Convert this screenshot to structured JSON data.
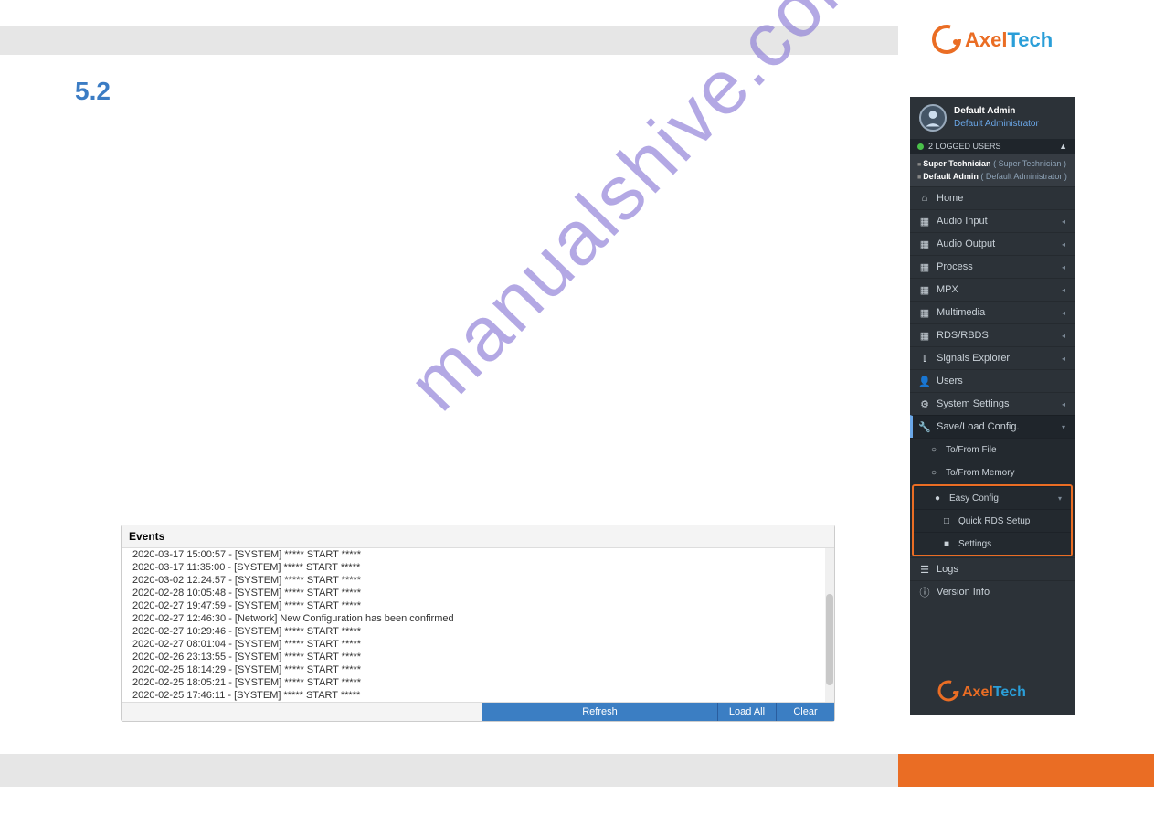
{
  "brand": {
    "part1": "Axel",
    "part2": "Tech"
  },
  "section_number": "5.2",
  "watermark": "manualshive.com",
  "events": {
    "title": "Events",
    "lines": [
      "2020-03-17 15:00:57 - [SYSTEM] ***** START *****",
      "2020-03-17 11:35:00 - [SYSTEM] ***** START *****",
      "2020-03-02 12:24:57 - [SYSTEM] ***** START *****",
      "2020-02-28 10:05:48 - [SYSTEM] ***** START *****",
      "2020-02-27 19:47:59 - [SYSTEM] ***** START *****",
      "2020-02-27 12:46:30 - [Network] New Configuration has been confirmed",
      "2020-02-27 10:29:46 - [SYSTEM] ***** START *****",
      "2020-02-27 08:01:04 - [SYSTEM] ***** START *****",
      "2020-02-26 23:13:55 - [SYSTEM] ***** START *****",
      "2020-02-25 18:14:29 - [SYSTEM] ***** START *****",
      "2020-02-25 18:05:21 - [SYSTEM] ***** START *****",
      "2020-02-25 17:46:11 - [SYSTEM] ***** START *****"
    ],
    "buttons": {
      "refresh": "Refresh",
      "loadall": "Load All",
      "clear": "Clear"
    }
  },
  "sidebar": {
    "user": {
      "name": "Default Admin",
      "role": "Default Administrator"
    },
    "logged_count": "2 LOGGED USERS",
    "logged_users": [
      {
        "name": "Super Technician",
        "role": "Super Technician"
      },
      {
        "name": "Default Admin",
        "role": "Default Administrator"
      }
    ],
    "nav": {
      "home": "Home",
      "audio_input": "Audio Input",
      "audio_output": "Audio Output",
      "process": "Process",
      "mpx": "MPX",
      "multimedia": "Multimedia",
      "rds": "RDS/RBDS",
      "signals": "Signals Explorer",
      "users": "Users",
      "system": "System Settings",
      "saveload": "Save/Load Config.",
      "tofromfile": "To/From File",
      "tofrommem": "To/From Memory",
      "easyconfig": "Easy Config",
      "quickrds": "Quick RDS Setup",
      "settings": "Settings",
      "logs": "Logs",
      "version": "Version Info"
    }
  }
}
